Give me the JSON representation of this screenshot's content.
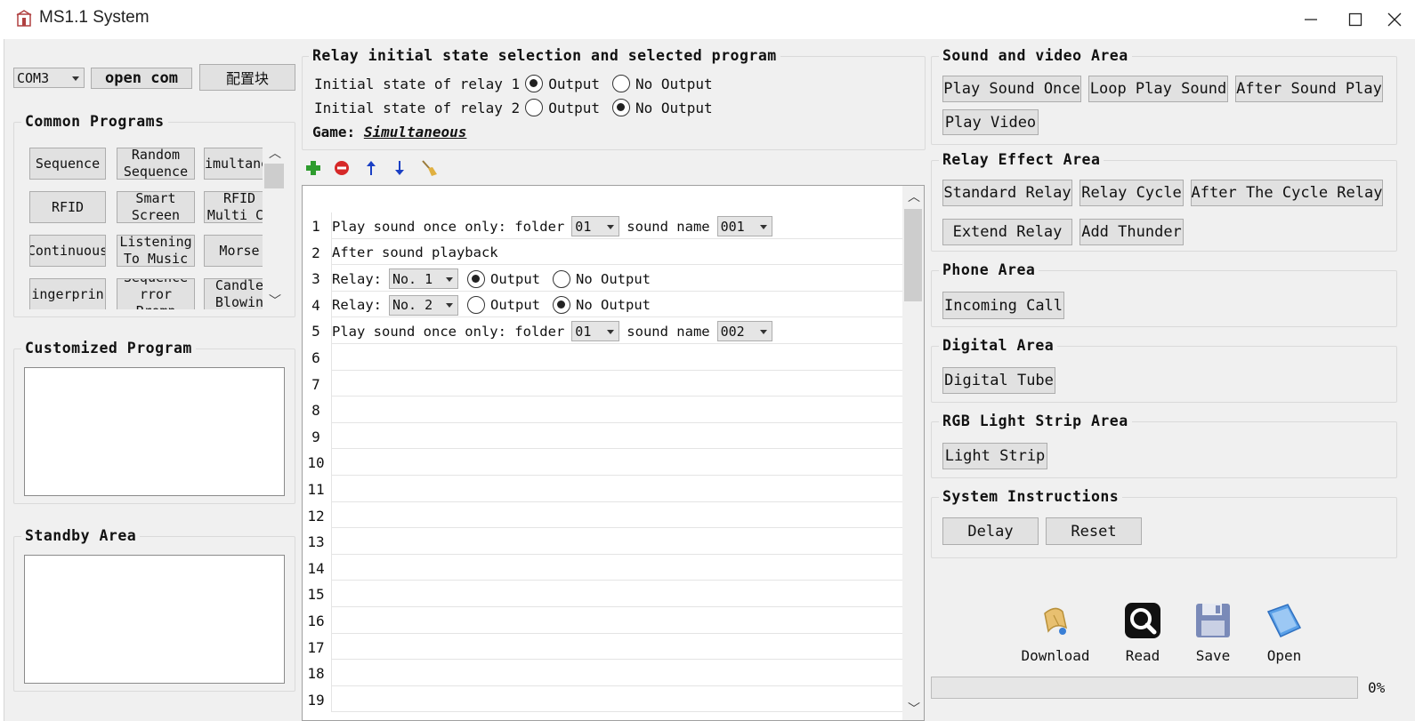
{
  "window": {
    "title": "MS1.1 System"
  },
  "left": {
    "com_port": "COM3",
    "open_com": "open com",
    "config_block": "配置块",
    "common_programs": {
      "title": "Common Programs",
      "buttons": [
        "Sequence",
        "Random\nSequence",
        "imultane",
        "RFID",
        "Smart\nScreen",
        "RFID\nMulti Ca",
        "Continuous",
        "Listening\nTo Music",
        "Morse",
        "ingerprin",
        "Sequence\nrror Promp",
        "Candle\nBlowin"
      ]
    },
    "customized_program": {
      "title": "Customized Program"
    },
    "standby_area": {
      "title": "Standby Area"
    }
  },
  "relay_state": {
    "title": "Relay initial state selection and selected program",
    "relay1_label": "Initial state of relay 1",
    "relay2_label": "Initial state of relay 2",
    "output": "Output",
    "no_output": "No Output",
    "relay1_selected": "output",
    "relay2_selected": "no_output",
    "game_label": "Game:",
    "game_value": "Simultaneous"
  },
  "toolbar": {
    "add": "add-icon",
    "remove": "remove-icon",
    "up": "arrow-up-icon",
    "down": "arrow-down-icon",
    "clear": "broom-icon"
  },
  "program_rows": {
    "r1": {
      "num": "1",
      "text": "Play sound once only: folder",
      "folder": "01",
      "sound_label": "sound name",
      "sound": "001"
    },
    "r2": {
      "num": "2",
      "text": "After sound playback"
    },
    "r3": {
      "num": "3",
      "text": "Relay:",
      "relay": "No. 1",
      "output": "Output",
      "no_output": "No Output",
      "selected": "output"
    },
    "r4": {
      "num": "4",
      "text": "Relay:",
      "relay": "No. 2",
      "output": "Output",
      "no_output": "No Output",
      "selected": "no_output"
    },
    "r5": {
      "num": "5",
      "text": "Play sound once only: folder",
      "folder": "01",
      "sound_label": "sound name",
      "sound": "002"
    },
    "empty_nums": [
      "6",
      "7",
      "8",
      "9",
      "10",
      "11",
      "12",
      "13",
      "14",
      "15",
      "16",
      "17",
      "18",
      "19"
    ]
  },
  "right": {
    "sound_video": {
      "title": "Sound and video Area",
      "buttons": [
        "Play Sound Once",
        "Loop Play Sound",
        "After Sound Play",
        "Play Video"
      ]
    },
    "relay_effect": {
      "title": "Relay Effect Area",
      "buttons": [
        "Standard Relay",
        "Relay Cycle",
        "After The Cycle Relay",
        "Extend Relay",
        "Add Thunder"
      ]
    },
    "phone": {
      "title": "Phone Area",
      "buttons": [
        "Incoming Call"
      ]
    },
    "digital": {
      "title": "Digital Area",
      "buttons": [
        "Digital Tube"
      ]
    },
    "rgb": {
      "title": "RGB Light Strip Area",
      "buttons": [
        "Light Strip"
      ]
    },
    "system": {
      "title": "System Instructions",
      "buttons": [
        "Delay",
        "Reset"
      ]
    },
    "tools": {
      "download": "Download",
      "read": "Read",
      "save": "Save",
      "open": "Open"
    },
    "progress": {
      "value": 0,
      "label": "0%"
    }
  }
}
